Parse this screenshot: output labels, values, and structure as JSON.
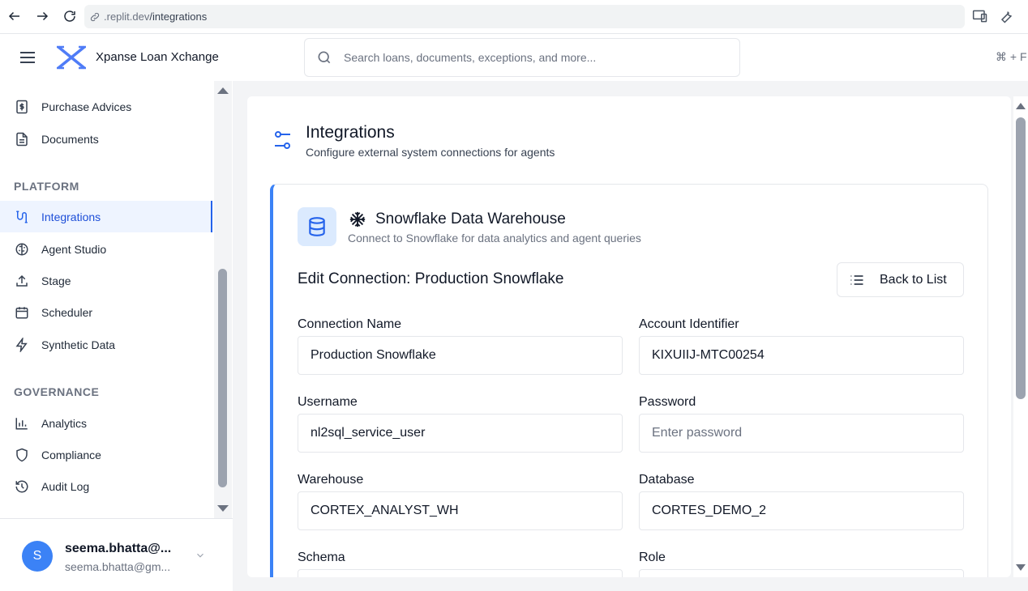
{
  "browser": {
    "url_host": ".replit.dev",
    "url_path": "/integrations"
  },
  "header": {
    "brand": "Xpanse Loan Xchange",
    "search_placeholder": "Search loans, documents, exceptions, and more...",
    "shortcut": "⌘ + F"
  },
  "sidebar": {
    "top_items": [
      {
        "label": "Purchase Advices",
        "icon": "dollar-document-icon"
      },
      {
        "label": "Documents",
        "icon": "document-icon"
      }
    ],
    "platform_label": "PLATFORM",
    "platform_items": [
      {
        "label": "Integrations",
        "icon": "integrations-icon",
        "active": true
      },
      {
        "label": "Agent Studio",
        "icon": "brain-icon"
      },
      {
        "label": "Stage",
        "icon": "upload-icon"
      },
      {
        "label": "Scheduler",
        "icon": "calendar-icon"
      },
      {
        "label": "Synthetic Data",
        "icon": "lightning-icon"
      }
    ],
    "governance_label": "GOVERNANCE",
    "governance_items": [
      {
        "label": "Analytics",
        "icon": "bar-chart-icon"
      },
      {
        "label": "Compliance",
        "icon": "shield-icon"
      },
      {
        "label": "Audit Log",
        "icon": "history-icon"
      }
    ],
    "user": {
      "initial": "S",
      "name": "seema.bhatta@...",
      "email": "seema.bhatta@gm..."
    }
  },
  "page": {
    "title": "Integrations",
    "subtitle": "Configure external system connections for agents"
  },
  "card": {
    "title": "Snowflake Data Warehouse",
    "subtitle": "Connect to Snowflake for data analytics and agent queries",
    "edit_title": "Edit Connection: Production Snowflake",
    "back_button": "Back to List"
  },
  "form": {
    "connection_name": {
      "label": "Connection Name",
      "value": "Production Snowflake"
    },
    "account_identifier": {
      "label": "Account Identifier",
      "value": "KIXUIIJ-MTC00254"
    },
    "username": {
      "label": "Username",
      "value": "nl2sql_service_user"
    },
    "password": {
      "label": "Password",
      "placeholder": "Enter password"
    },
    "warehouse": {
      "label": "Warehouse",
      "value": "CORTEX_ANALYST_WH"
    },
    "database": {
      "label": "Database",
      "value": "CORTES_DEMO_2"
    },
    "schema": {
      "label": "Schema"
    },
    "role": {
      "label": "Role"
    }
  },
  "colors": {
    "accent": "#2563eb",
    "active_bg": "#eef4ff",
    "card_border_accent": "#3b82f6"
  }
}
